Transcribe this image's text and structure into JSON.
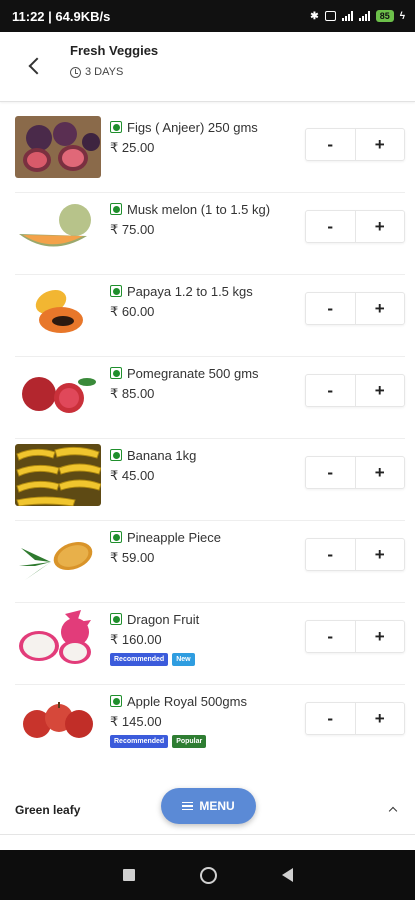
{
  "status": {
    "time_speed": "11:22 | 64.9KB/s",
    "battery": "85"
  },
  "header": {
    "title": "Fresh Veggies",
    "subtitle": "3 DAYS"
  },
  "stepper": {
    "minus": "-",
    "plus": "+"
  },
  "products": [
    {
      "name": "Figs ( Anjeer) 250 gms",
      "price": "₹ 25.00",
      "image": "figs-image"
    },
    {
      "name": "Musk melon (1 to 1.5 kg)",
      "price": "₹ 75.00",
      "image": "musk-melon-image"
    },
    {
      "name": "Papaya 1.2 to 1.5 kgs",
      "price": "₹ 60.00",
      "image": "papaya-image"
    },
    {
      "name": "Pomegranate 500 gms",
      "price": "₹ 85.00",
      "image": "pomegranate-image"
    },
    {
      "name": "Banana 1kg",
      "price": "₹ 45.00",
      "image": "banana-image"
    },
    {
      "name": "Pineapple Piece",
      "price": "₹ 59.00",
      "image": "pineapple-image"
    },
    {
      "name": "Dragon Fruit",
      "price": "₹ 160.00",
      "image": "dragon-fruit-image",
      "tags": [
        {
          "label": "Recommended",
          "color": "#3b5bdb"
        },
        {
          "label": "New",
          "color": "#2f9de0"
        }
      ]
    },
    {
      "name": "Apple Royal 500gms",
      "price": "₹ 145.00",
      "image": "apple-image",
      "tags": [
        {
          "label": "Recommended",
          "color": "#3b5bdb"
        },
        {
          "label": "Popular",
          "color": "#2e7d32"
        }
      ]
    }
  ],
  "section": {
    "title": "Green leafy"
  },
  "menu_button": {
    "label": "MENU",
    "color": "#5b8ad6"
  },
  "colors": {
    "veg_indicator": "#1f8f2c"
  }
}
